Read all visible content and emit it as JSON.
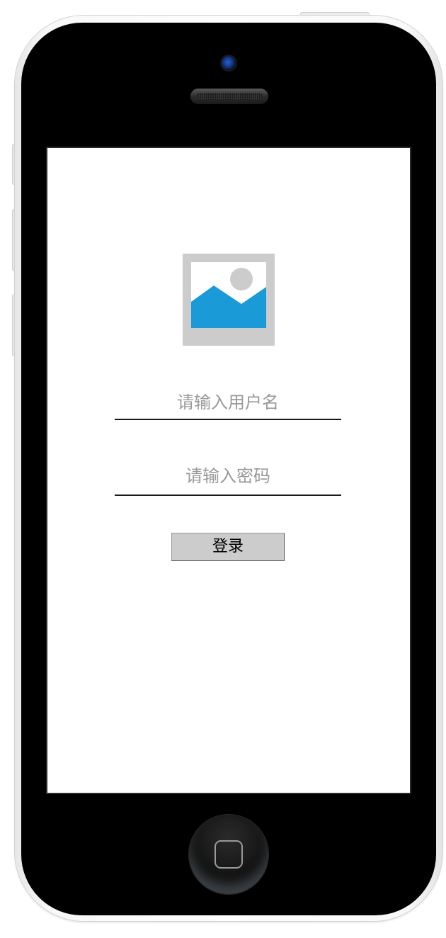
{
  "login_form": {
    "username_placeholder": "请输入用户名",
    "password_placeholder": "请输入密码",
    "login_button_label": "登录"
  },
  "colors": {
    "screen_background": "#ffffff",
    "phone_body": "#000000",
    "image_placeholder_frame": "#cccccc",
    "image_placeholder_mountain": "#1a9ad6",
    "placeholder_text": "#999999",
    "button_background": "#cccccc"
  },
  "icons": {
    "logo": "image-placeholder-icon",
    "home_button": "home-square-icon"
  }
}
